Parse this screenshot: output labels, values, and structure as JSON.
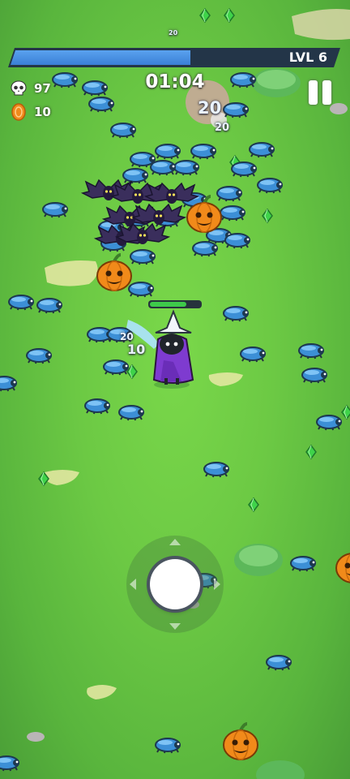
{
  "hud": {
    "level_label": "LVL 6",
    "xp_progress": 0.55,
    "timer": "01:04",
    "kills": "97",
    "coins": "10",
    "colors": {
      "xp_fill": "#4a90e2",
      "xp_track": "#233548",
      "hp_fill": "#3ec94a"
    }
  },
  "player": {
    "health_fraction": 0.72
  },
  "icons": {
    "kills": "skull-icon",
    "coins": "coin-icon",
    "pause": "pause-icon",
    "gem": "green-gem-icon",
    "enemy": "blue-beetle-icon",
    "bat": "bat-icon",
    "pumpkin": "pumpkin-icon"
  },
  "damage_numbers": [
    {
      "id": "dmg-boulder",
      "text": "20"
    },
    {
      "id": "dmg-top",
      "text": "20"
    },
    {
      "id": "dmg-top-small",
      "text": "20"
    },
    {
      "id": "dmg-near-player",
      "text": "20"
    },
    {
      "id": "dmg-player-10",
      "text": "10"
    }
  ]
}
